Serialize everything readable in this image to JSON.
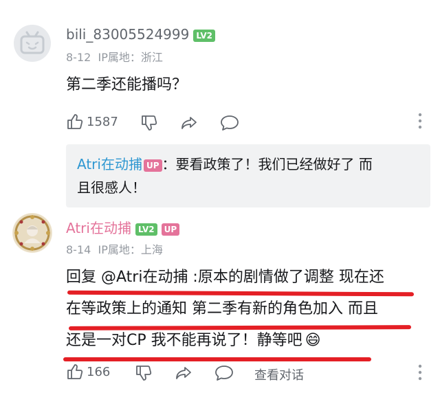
{
  "comment1": {
    "username": "bili_83005524999",
    "level": "LV2",
    "date": "8-12",
    "ip_location": "IP属地：浙江",
    "content": "第二季还能播吗？",
    "like_count": "1587"
  },
  "reply_preview": {
    "name": "Atri在动捕",
    "badge": "UP",
    "line1": "：要看政策了！我们已经做好了 而",
    "line2": "且很感人！"
  },
  "comment2": {
    "username": "Atri在动捕",
    "level": "LV2",
    "badge": "UP",
    "date": "8-14",
    "ip_location": "IP属地：上海",
    "line1": "回复 @Atri在动捕 :原本的剧情做了调整 现在还",
    "line2": "在等政策上的通知 第二季有新的角色加入 而且",
    "line3": "还是一对CP 我不能再说了！静等吧",
    "emoji": "😄",
    "like_count": "166",
    "view_conversation": "查看对话"
  },
  "colors": {
    "accent_pink": "#e4739a",
    "level_green": "#5fbf68",
    "link_blue": "#2e97d1",
    "annotation_red": "#e41f25"
  }
}
